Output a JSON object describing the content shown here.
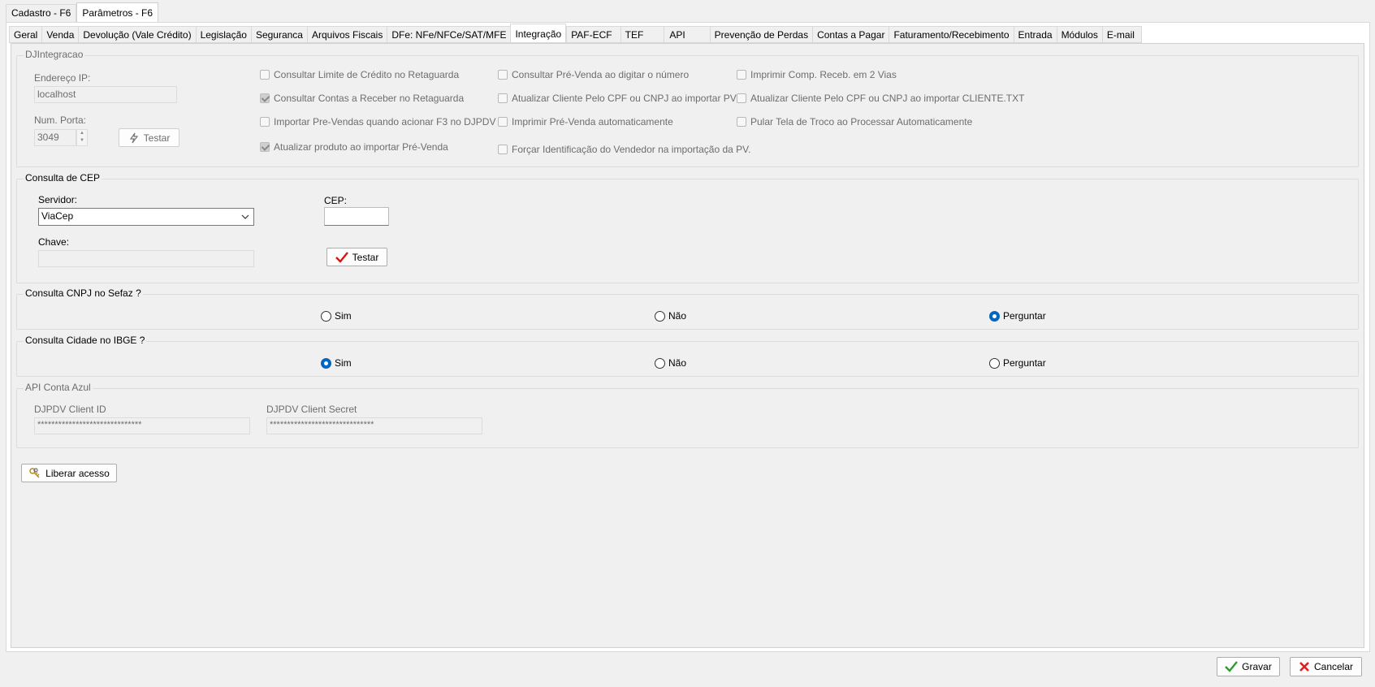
{
  "outer_tabs": [
    "Cadastro - F6",
    "Parâmetros - F6"
  ],
  "inner_tabs": [
    "Geral",
    "Venda",
    "Devolução (Vale Crédito)",
    "Legislação",
    "Seguranca",
    "Arquivos Fiscais",
    "DFe: NFe/NFCe/SAT/MFE",
    "Integração",
    "PAF-ECF",
    "TEF",
    "API",
    "Prevenção de Perdas",
    "Contas a Pagar",
    "Faturamento/Recebimento",
    "Entrada",
    "Módulos",
    "E-mail"
  ],
  "djintegracao": {
    "legend": "DJIntegracao",
    "ip_label": "Endereço IP:",
    "ip_value": "localhost",
    "port_label": "Num. Porta:",
    "port_value": "3049",
    "test_button": "Testar",
    "checkboxes": {
      "c1": {
        "label": "Consultar Limite de Crédito no Retaguarda",
        "checked": false
      },
      "c2": {
        "label": "Consultar Contas a Receber no Retaguarda",
        "checked": true
      },
      "c3": {
        "label": "Importar Pre-Vendas quando acionar F3 no DJPDV",
        "checked": false
      },
      "c4": {
        "label": "Atualizar produto ao importar Pré-Venda",
        "checked": true
      },
      "c5": {
        "label": "Consultar Pré-Venda ao digitar o número",
        "checked": false
      },
      "c6": {
        "label": "Atualizar Cliente Pelo CPF ou CNPJ ao importar PV",
        "checked": false
      },
      "c7": {
        "label": "Imprimir Pré-Venda automaticamente",
        "checked": false
      },
      "c8": {
        "label": "Forçar Identificação do Vendedor na importação da PV.",
        "checked": false
      },
      "c9": {
        "label": "Imprimir Comp. Receb. em 2 Vias",
        "checked": false
      },
      "c10": {
        "label": "Atualizar Cliente Pelo CPF ou CNPJ ao importar CLIENTE.TXT",
        "checked": false
      },
      "c11": {
        "label": "Pular Tela de Troco ao Processar Automaticamente",
        "checked": false
      }
    }
  },
  "cep": {
    "legend": "Consulta de CEP",
    "server_label": "Servidor:",
    "server_value": "ViaCep",
    "cep_label": "CEP:",
    "cep_value": "",
    "key_label": "Chave:",
    "key_value": "",
    "test_button": "Testar"
  },
  "cnpj": {
    "legend": "Consulta CNPJ no Sefaz ?",
    "options": [
      "Sim",
      "Não",
      "Perguntar"
    ],
    "selected": "Perguntar"
  },
  "ibge": {
    "legend": "Consulta Cidade no IBGE ?",
    "options": [
      "Sim",
      "Não",
      "Perguntar"
    ],
    "selected": "Sim"
  },
  "conta_azul": {
    "legend": "API Conta Azul",
    "client_id_label": "DJPDV Client ID",
    "client_id_value": "******************************",
    "client_secret_label": "DJPDV Client Secret",
    "client_secret_value": "******************************"
  },
  "liberar_button": "Liberar acesso",
  "footer": {
    "save": "Gravar",
    "cancel": "Cancelar"
  },
  "colors": {
    "accent": "#0067c0",
    "cancel_icon": "#e02020",
    "check_icon": "#2a9d2a"
  }
}
